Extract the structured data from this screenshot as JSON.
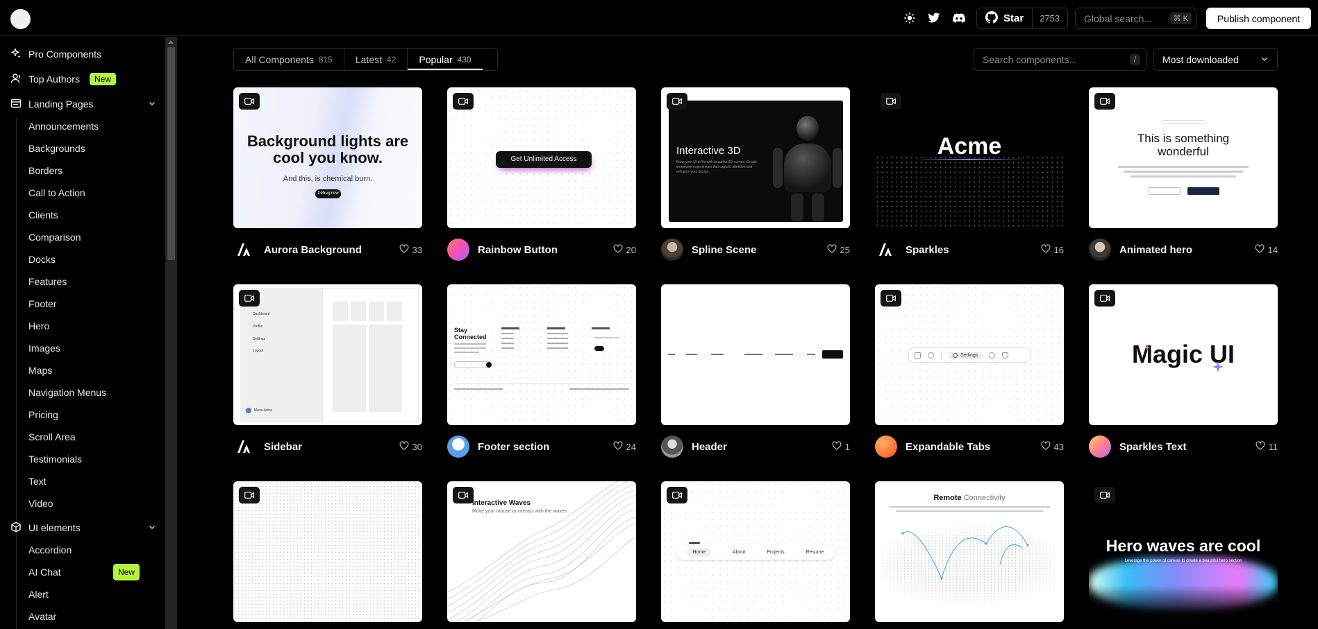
{
  "header": {
    "github": {
      "label": "Star",
      "count": "2753"
    },
    "search": {
      "placeholder": "Global search...",
      "shortcut": "⌘ K"
    },
    "publish_label": "Publish component"
  },
  "sidebar": {
    "top": [
      {
        "label": "Pro Components",
        "icon": "sparkle-icon"
      },
      {
        "label": "Top Authors",
        "icon": "user-icon",
        "badge": "New"
      }
    ],
    "landing": {
      "label": "Landing Pages",
      "icon": "layout-icon",
      "items": [
        "Announcements",
        "Backgrounds",
        "Borders",
        "Call to Action",
        "Clients",
        "Comparison",
        "Docks",
        "Features",
        "Footer",
        "Hero",
        "Images",
        "Maps",
        "Navigation Menus",
        "Pricing",
        "Scroll Area",
        "Testimonials",
        "Text",
        "Video"
      ]
    },
    "ui": {
      "label": "UI elements",
      "icon": "cube-icon",
      "items": [
        {
          "label": "Accordion"
        },
        {
          "label": "AI Chat",
          "badge": "New"
        },
        {
          "label": "Alert"
        },
        {
          "label": "Avatar"
        }
      ]
    }
  },
  "tabs": [
    {
      "label": "All Components",
      "count": "815"
    },
    {
      "label": "Latest",
      "count": "42"
    },
    {
      "label": "Popular",
      "count": "430",
      "active": true
    }
  ],
  "search": {
    "placeholder": "Search components...",
    "shortcut": "/"
  },
  "sort": {
    "selected": "Most downloaded"
  },
  "cards": [
    {
      "title": "Aurora Background",
      "likes": "33",
      "preview": {
        "heading": "Background lights are cool you know.",
        "sub": "And this, is chemical burn.",
        "button": "Debug now"
      }
    },
    {
      "title": "Rainbow Button",
      "likes": "20",
      "preview": {
        "button": "Get Unlimited Access"
      }
    },
    {
      "title": "Spline Scene",
      "likes": "25",
      "preview": {
        "heading": "Interactive 3D",
        "sub": "Bring your UI to life with beautiful 3D scenes. Create immersive experiences that capture attention and enhance your design."
      }
    },
    {
      "title": "Sparkles",
      "likes": "16",
      "preview": {
        "heading": "Acme"
      }
    },
    {
      "title": "Animated hero",
      "likes": "14",
      "preview": {
        "heading": "This is something wonderful"
      }
    },
    {
      "title": "Sidebar",
      "likes": "30",
      "preview": {
        "items": [
          "Dashboard",
          "Profile",
          "Settings",
          "Logout"
        ],
        "user": "Manu Arora"
      }
    },
    {
      "title": "Footer section",
      "likes": "24",
      "preview": {
        "heading": "Stay Connected"
      }
    },
    {
      "title": "Header",
      "likes": "1"
    },
    {
      "title": "Expandable Tabs",
      "likes": "43",
      "preview": {
        "label": "Settings"
      }
    },
    {
      "title": "Sparkles Text",
      "likes": "11",
      "preview": {
        "heading": "Magic UI"
      }
    },
    {},
    {
      "preview": {
        "heading": "Interactive Waves",
        "sub": "Move your mouse to interact with the waves"
      }
    },
    {
      "preview": {
        "items": [
          "Home",
          "About",
          "Projects",
          "Resume"
        ]
      }
    },
    {
      "preview": {
        "heading_bold": "Remote",
        "heading_light": "Connectivity"
      }
    },
    {
      "preview": {
        "heading": "Hero waves are cool",
        "sub": "Leverage the power of canvas to create a beautiful hero section"
      }
    }
  ]
}
